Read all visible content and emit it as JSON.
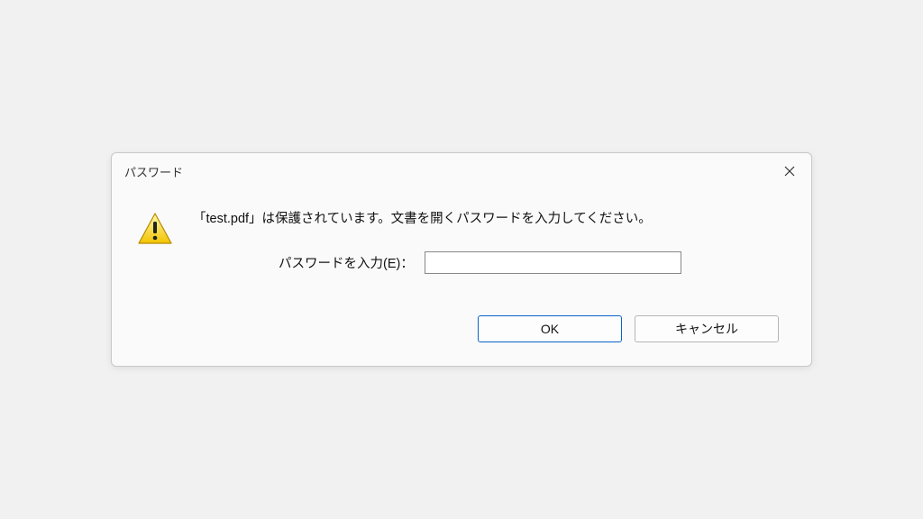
{
  "dialog": {
    "title": "パスワード",
    "message": "「test.pdf」は保護されています。文書を開くパスワードを入力してください。",
    "input_label": "パスワードを入力(E)：",
    "input_value": "",
    "ok_label": "OK",
    "cancel_label": "キャンセル"
  }
}
